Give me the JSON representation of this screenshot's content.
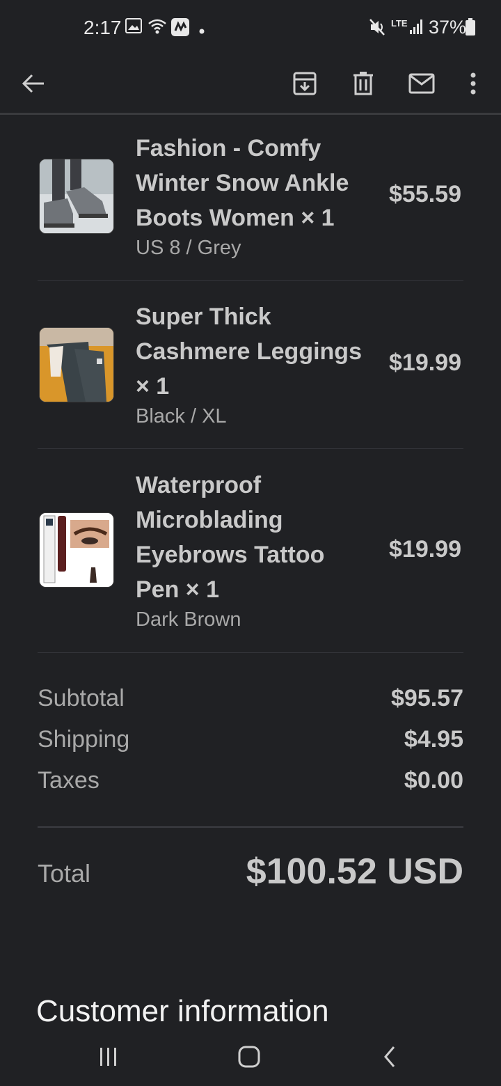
{
  "status_bar": {
    "time": "2:17",
    "battery": "37%",
    "network": "LTE",
    "icons": [
      "gallery-icon",
      "wifi-icon",
      "app-notification-icon",
      "dot-icon",
      "mute-icon",
      "signal-icon",
      "battery-icon"
    ]
  },
  "toolbar": {
    "icons": [
      "back-arrow-icon",
      "archive-icon",
      "delete-icon",
      "mail-icon",
      "more-vert-icon"
    ]
  },
  "items": [
    {
      "name": "Fashion - Comfy Winter Snow Ankle Boots Women × 1",
      "variant": "US 8 / Grey",
      "price": "$55.59"
    },
    {
      "name": "Super Thick Cashmere Leggings × 1",
      "variant": "Black / XL",
      "price": "$19.99"
    },
    {
      "name": "Waterproof Microblading Eyebrows Tattoo Pen × 1",
      "variant": "Dark Brown",
      "price": "$19.99"
    }
  ],
  "summary": {
    "subtotal_label": "Subtotal",
    "subtotal_value": "$95.57",
    "shipping_label": "Shipping",
    "shipping_value": "$4.95",
    "taxes_label": "Taxes",
    "taxes_value": "$0.00",
    "total_label": "Total",
    "total_value": "$100.52 USD"
  },
  "customer_section": {
    "heading": "Customer information"
  },
  "navbar": {
    "icons": [
      "recent-apps-icon",
      "home-icon",
      "back-icon"
    ]
  },
  "colors": {
    "background": "#202124",
    "text_primary": "#c9c9c9",
    "text_secondary": "#a9a9a9",
    "heading": "#f2f2f2"
  }
}
